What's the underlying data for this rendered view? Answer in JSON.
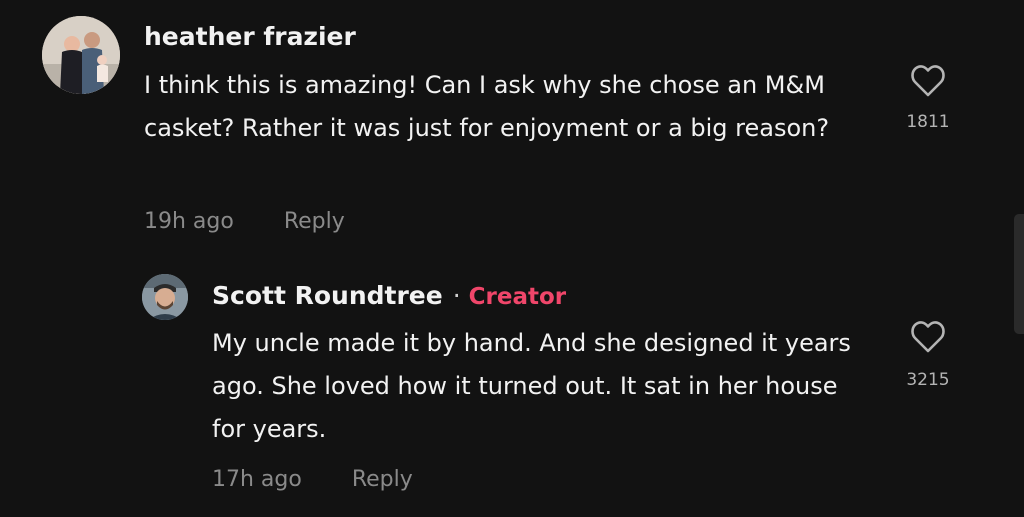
{
  "comments": [
    {
      "author": "heather frazier",
      "text": "I think this is amazing! Can I ask why she chose an M&M casket? Rather it was just for enjoyment or a big reason?",
      "time": "19h ago",
      "reply_label": "Reply",
      "likes": "1811",
      "avatar_icon": "user-avatar-photo"
    },
    {
      "author": "Scott Roundtree",
      "separator": "·",
      "badge": "Creator",
      "text": "My uncle made it by hand. And she designed it years ago. She loved how it turned out. It sat in her house for years.",
      "time": "17h ago",
      "reply_label": "Reply",
      "likes": "3215",
      "avatar_icon": "user-avatar-photo"
    }
  ],
  "colors": {
    "background": "#121212",
    "creator_badge": "#f0466a",
    "meta_text": "#8a8a8a"
  }
}
